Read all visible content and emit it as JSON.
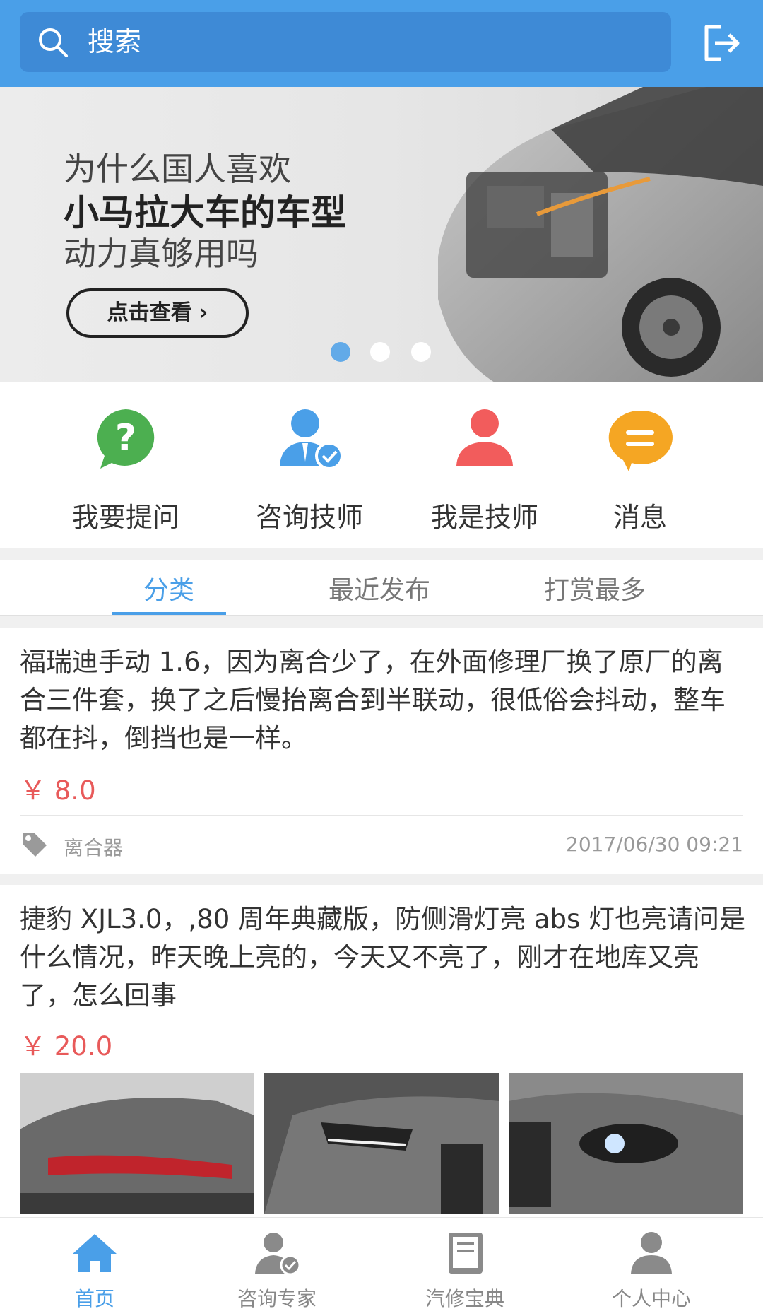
{
  "search": {
    "placeholder": "搜索"
  },
  "banner": {
    "line1": "为什么国人喜欢",
    "line2": "小马拉大车的车型",
    "line3": "动力真够用吗",
    "cta": "点击查看 ›"
  },
  "quick_actions": [
    {
      "label": "我要提问"
    },
    {
      "label": "咨询技师"
    },
    {
      "label": "我是技师"
    },
    {
      "label": "消息"
    }
  ],
  "tabs": [
    {
      "label": "分类"
    },
    {
      "label": "最近发布"
    },
    {
      "label": "打赏最多"
    }
  ],
  "posts": [
    {
      "text": "福瑞迪手动 1.6，因为离合少了，在外面修理厂换了原厂的离合三件套，换了之后慢抬离合到半联动，很低俗会抖动，整车都在抖，倒挡也是一样。",
      "price": "￥ 8.0",
      "tag": "离合器",
      "date": "2017/06/30 09:21"
    },
    {
      "text": "捷豹 XJL3.0，,80 周年典藏版，防侧滑灯亮 abs 灯也亮请问是什么情况，昨天晚上亮的，今天又不亮了，刚才在地库又亮了，怎么回事",
      "price": "￥ 20.0"
    }
  ],
  "bottom_nav": [
    {
      "label": "首页",
      "active": true
    },
    {
      "label": "咨询专家"
    },
    {
      "label": "汽修宝典"
    },
    {
      "label": "个人中心"
    }
  ],
  "colors": {
    "primary": "#4a9fe8",
    "price": "#e85a5a",
    "question_green": "#4caf50",
    "tech_red": "#f25c5c",
    "msg_orange": "#f5a623"
  }
}
